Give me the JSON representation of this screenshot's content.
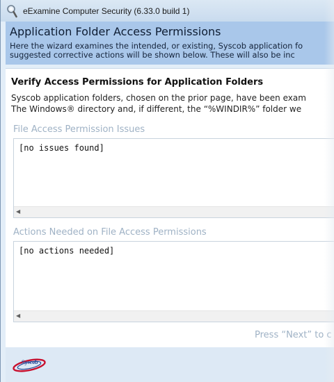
{
  "window": {
    "title": "eExamine Computer Security (6.33.0 build 1)"
  },
  "header": {
    "title": "Application Folder Access Permissions",
    "description_lines": [
      "Here the wizard examines the intended, or existing, Syscob application fo",
      "suggested corrective actions will be shown below.  These will also be inc"
    ]
  },
  "section": {
    "title": "Verify Access Permissions for Application Folders",
    "description_lines": [
      "Syscob application folders, chosen on the prior page, have been exam",
      "The Windows® directory and, if different, the “%WINDIR%” folder we"
    ]
  },
  "issues": {
    "label": "File Access Permission Issues",
    "text": "[no issues found]"
  },
  "actions": {
    "label": "Actions Needed on File Access Permissions",
    "text": "[no actions needed]"
  },
  "hint": "Press “Next” to c",
  "footer": {
    "logo_text": "Syscob"
  },
  "colors": {
    "header_bg": "#a9c7ea",
    "label_muted": "#9fb2c5",
    "logo_red": "#c8102e",
    "logo_blue": "#1f3f8f"
  },
  "icons": {
    "app": "magnifier-shield-icon",
    "scroll_left": "scroll-left-arrow-icon",
    "logo": "syscob-logo"
  }
}
